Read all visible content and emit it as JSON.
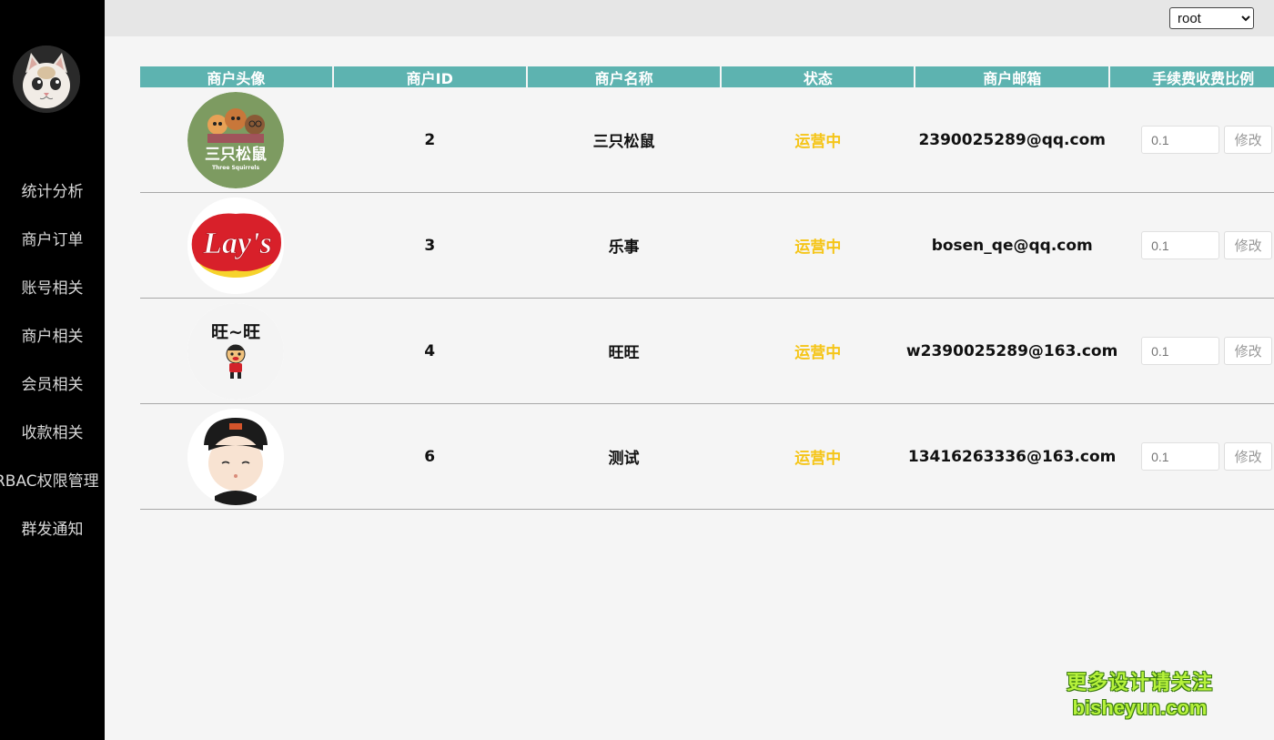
{
  "sidebar": {
    "avatar_icon": "cat-photo-icon",
    "items": [
      {
        "label": "统计分析"
      },
      {
        "label": "商户订单"
      },
      {
        "label": "账号相关"
      },
      {
        "label": "商户相关"
      },
      {
        "label": "会员相关"
      },
      {
        "label": "收款相关"
      },
      {
        "label": "RBAC权限管理"
      },
      {
        "label": "群发通知"
      }
    ]
  },
  "header": {
    "user_select": {
      "value": "root",
      "options": [
        "root"
      ]
    }
  },
  "table": {
    "columns": [
      "商户头像",
      "商户ID",
      "商户名称",
      "状态",
      "商户邮箱",
      "手续费收费比例"
    ],
    "rows": [
      {
        "logo": "three-squirrels-logo",
        "logo_text": "三只松鼠",
        "logo_sub": "Three Squirrels",
        "id": "2",
        "name": "三只松鼠",
        "status": "运营中",
        "email": "2390025289@qq.com",
        "rate_placeholder": "0.1",
        "edit": "修改"
      },
      {
        "logo": "lays-logo",
        "logo_text": "Lay's",
        "id": "3",
        "name": "乐事",
        "status": "运营中",
        "email": "bosen_qe@qq.com",
        "rate_placeholder": "0.1",
        "edit": "修改"
      },
      {
        "logo": "wangwang-logo",
        "logo_text": "旺~旺",
        "id": "4",
        "name": "旺旺",
        "status": "运营中",
        "email": "w2390025289@163.com",
        "rate_placeholder": "0.1",
        "edit": "修改"
      },
      {
        "logo": "cartoon-boy-avatar",
        "id": "6",
        "name": "测试",
        "status": "运营中",
        "email": "13416263336@163.com",
        "rate_placeholder": "0.1",
        "edit": "修改"
      }
    ]
  },
  "watermark": {
    "line1": "更多设计请关注",
    "line2": "bisheyun.com"
  },
  "colors": {
    "header_bg": "#5db3b0",
    "status": "#f5c518",
    "sidebar_bg": "#000000"
  }
}
